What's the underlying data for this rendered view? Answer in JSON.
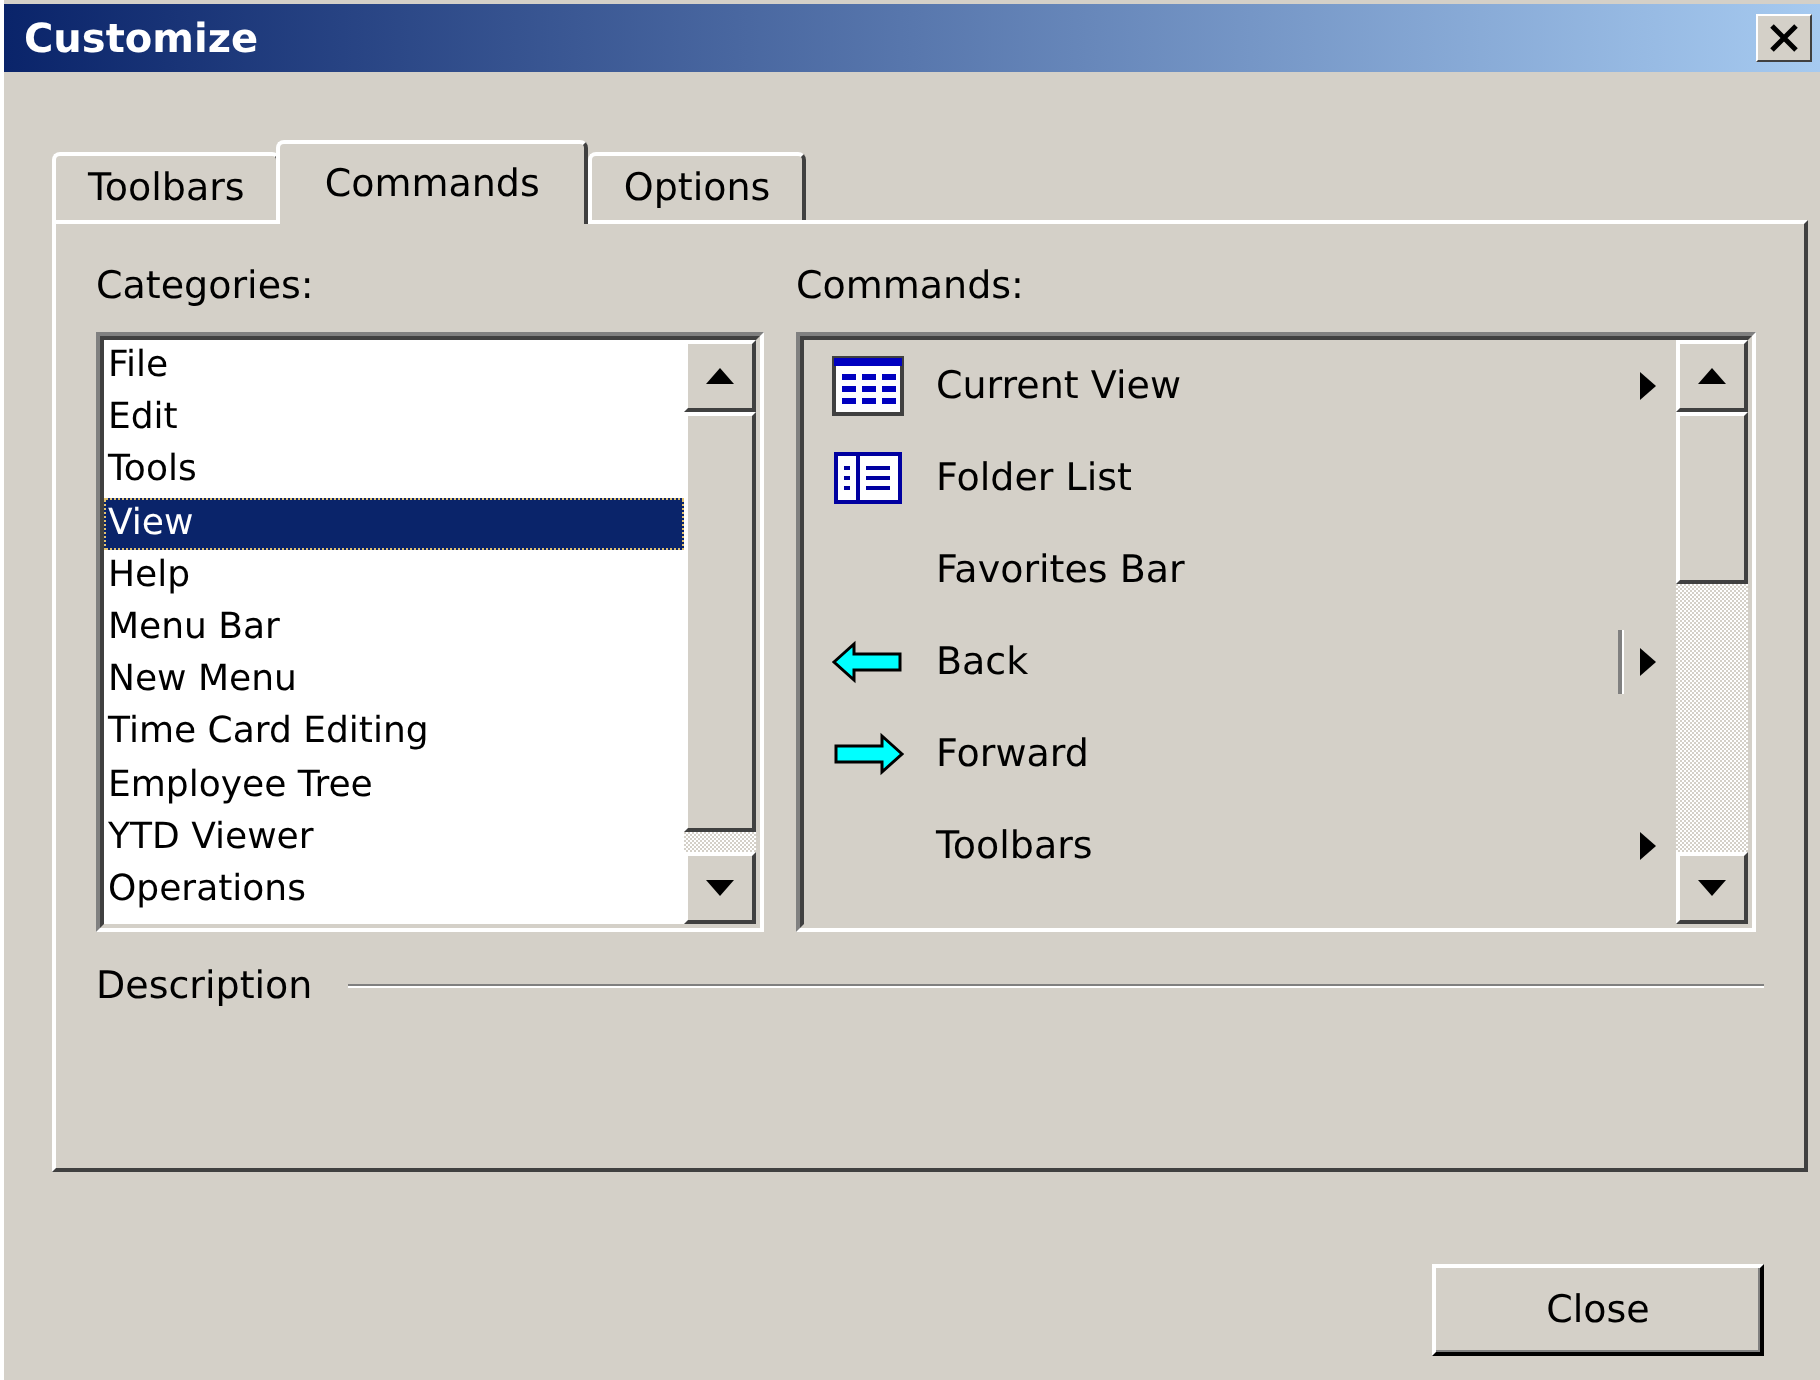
{
  "window": {
    "title": "Customize"
  },
  "tabs": [
    {
      "label": "Toolbars",
      "selected": false
    },
    {
      "label": "Commands",
      "selected": true
    },
    {
      "label": "Options",
      "selected": false
    }
  ],
  "categories": {
    "label": "Categories:",
    "items": [
      {
        "label": "File",
        "selected": false
      },
      {
        "label": "Edit",
        "selected": false
      },
      {
        "label": "Tools",
        "selected": false
      },
      {
        "label": "View",
        "selected": true
      },
      {
        "label": "Help",
        "selected": false
      },
      {
        "label": "Menu Bar",
        "selected": false
      },
      {
        "label": "New Menu",
        "selected": false
      },
      {
        "label": "Time Card Editing",
        "selected": false
      },
      {
        "label": "Employee Tree",
        "selected": false
      },
      {
        "label": "YTD Viewer",
        "selected": false
      },
      {
        "label": "Operations",
        "selected": false
      }
    ]
  },
  "commands": {
    "label": "Commands:",
    "items": [
      {
        "label": "Current View",
        "kind": "grid",
        "submenu": true,
        "split": false
      },
      {
        "label": "Folder List",
        "kind": "list",
        "submenu": false,
        "split": false
      },
      {
        "label": "Favorites Bar",
        "kind": "plain",
        "submenu": false,
        "split": false
      },
      {
        "label": "Back",
        "kind": "back",
        "submenu": true,
        "split": true
      },
      {
        "label": "Forward",
        "kind": "forward",
        "submenu": false,
        "split": false
      },
      {
        "label": "Toolbars",
        "kind": "plain",
        "submenu": true,
        "split": false
      }
    ]
  },
  "description": {
    "label": "Description"
  },
  "buttons": [
    {
      "label": "Close"
    }
  ]
}
